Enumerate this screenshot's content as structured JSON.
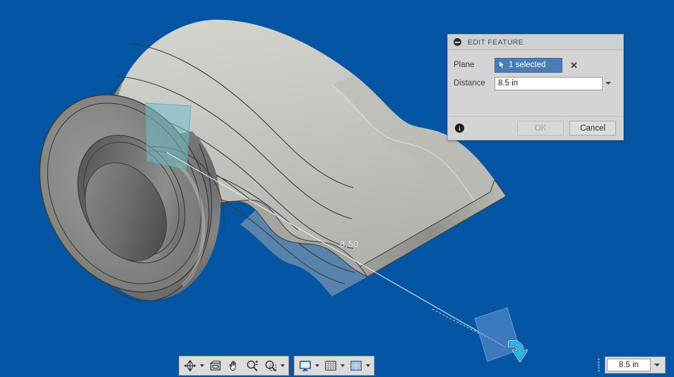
{
  "app": {
    "background_color": "#0455a4",
    "model_name": "rolled-corrugated-sheet-metal"
  },
  "viewport": {
    "dimension_label": "8.50",
    "plane_highlight_color": "#6fc0cc",
    "selection_plane_color": "#4d84c4",
    "model_surface_color": "#c9c9c4",
    "model_shadow_color": "#6e6e6e"
  },
  "edit_dialog": {
    "title": "EDIT FEATURE",
    "collapse_icon": "minus-circle-icon",
    "plane": {
      "label": "Plane",
      "selection_value": "1 selected",
      "select_cursor_icon": "cursor-arrow-icon",
      "clear_label": "✕"
    },
    "distance": {
      "label": "Distance",
      "value": "8.5 in",
      "placeholder": "Distance",
      "dropdown_icon": "chevron-down-icon"
    },
    "footer": {
      "info_icon": "info-icon",
      "info_glyph": "i",
      "ok_label": "OK",
      "ok_enabled": false,
      "cancel_label": "Cancel",
      "cancel_enabled": true
    }
  },
  "nav_toolbar": {
    "groups": [
      {
        "name": "navigation-group",
        "items": [
          {
            "icon": "orbit-icon",
            "label": "Orbit",
            "has_dropdown": true
          },
          {
            "icon": "look-at-icon",
            "label": "Look At",
            "has_dropdown": false
          },
          {
            "icon": "pan-icon",
            "label": "Pan",
            "has_dropdown": false
          },
          {
            "icon": "zoom-icon",
            "label": "Zoom",
            "has_dropdown": false
          },
          {
            "icon": "zoom-window-icon",
            "label": "Zoom Window",
            "has_dropdown": true
          }
        ]
      },
      {
        "name": "display-group",
        "items": [
          {
            "icon": "display-settings-icon",
            "label": "Display Settings",
            "has_dropdown": true
          },
          {
            "icon": "grid-snap-icon",
            "label": "Grid and Snaps",
            "has_dropdown": true
          },
          {
            "icon": "viewports-icon",
            "label": "Viewports",
            "has_dropdown": true
          }
        ]
      }
    ]
  },
  "value_box": {
    "grip_icon": "drag-grip-icon",
    "value": "8.5 in",
    "placeholder": "Value",
    "dropdown_icon": "chevron-down-icon"
  }
}
